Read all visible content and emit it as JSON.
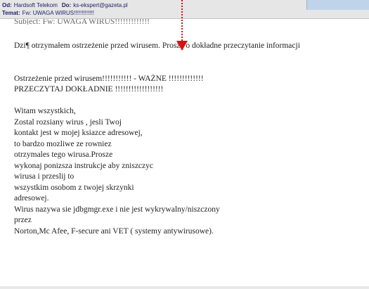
{
  "header": {
    "from_label": "Od:",
    "from_value": "Hardsoft Telekom",
    "to_label": "Do:",
    "to_value": "ks-ekspert@gazeta.pl",
    "subject_label": "Temat:",
    "subject_value": "Fw: UWAGA WIRUS!!!!!!!!!!!!!"
  },
  "cut_line": "Subject: Fw: UWAGA WIRUS!!!!!!!!!!!!!",
  "body": {
    "line1": "Dzi¶ otrzymałem ostrzeżenie przed wirusem. Proszę o dokładne przeczytanie informacji",
    "warn1": "Ostrzeżenie przed wirusem!!!!!!!!!!! - WAŻNE !!!!!!!!!!!!!",
    "warn2": "PRZECZYTAJ DOKŁADNIE !!!!!!!!!!!!!!!!!!",
    "lines": [
      "Witam wszystkich,",
      "Zostal rozsiany wirus , jesli Twoj",
      "kontakt jest w mojej ksiazce adresowej,",
      "to bardzo mozliwe ze rowniez",
      "otrzymales tego wirusa.Prosze",
      "wykonaj ponizsza instrukcje aby zniszczyc",
      "wirusa i przeslij to",
      "wszystkim osobom z twojej skrzynki",
      "adresowej.",
      "Wirus nazywa sie jdbgmgr.exe i nie jest wykrywalny/niszczony",
      "przez",
      "Norton,Mc Afee, F-secure ani VET ( systemy antywirusowe)."
    ]
  }
}
